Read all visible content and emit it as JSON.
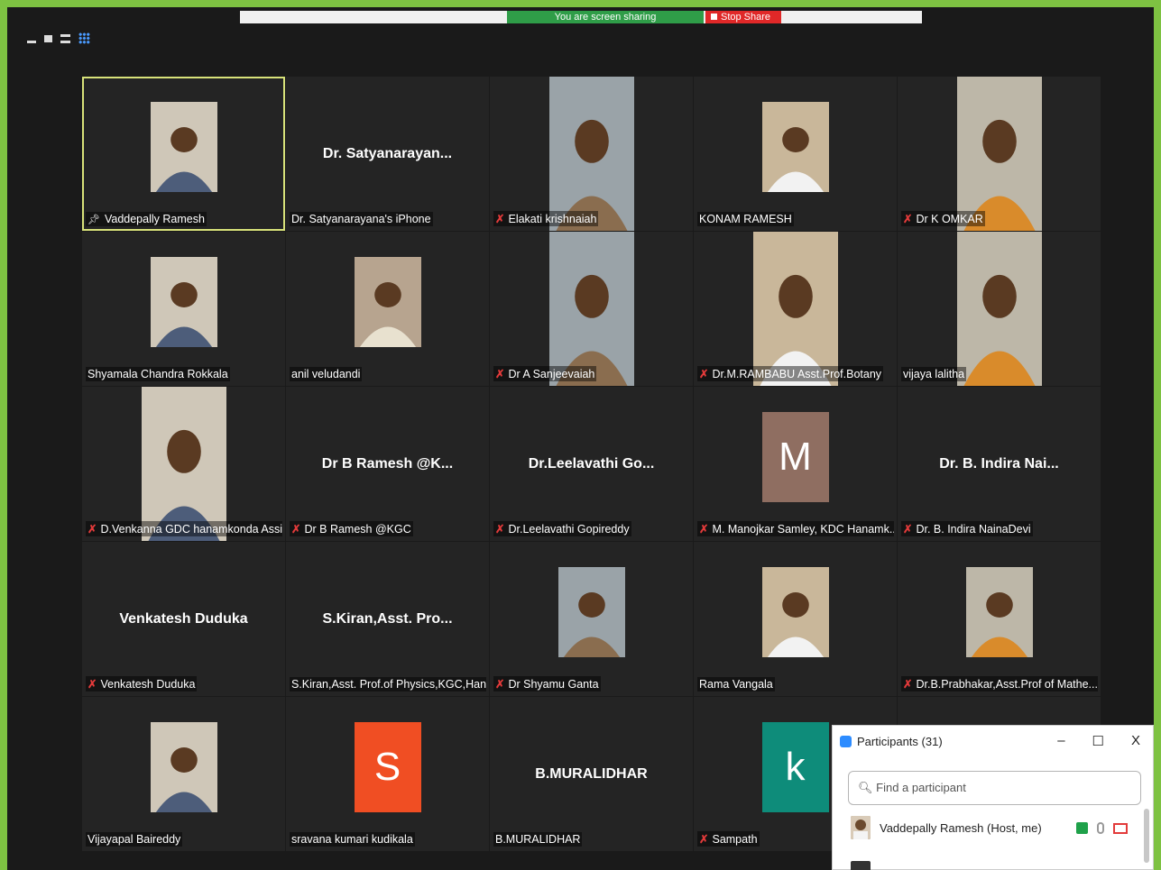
{
  "share_bar": {
    "status_text": "You are screen sharing",
    "stop_label": "Stop Share"
  },
  "tiles": [
    {
      "big": "",
      "caption": "Vaddepally Ramesh",
      "pin": true,
      "muted": false,
      "img": "photo-vaddepally",
      "active": true
    },
    {
      "big": "Dr. Satyanarayan...",
      "caption": "Dr. Satyanarayana's iPhone",
      "muted": false
    },
    {
      "big": "",
      "caption": "Elakati krishnaiah",
      "muted": true,
      "img": "video-elakati",
      "wide": true
    },
    {
      "big": "",
      "caption": "KONAM RAMESH",
      "muted": false,
      "img": "photo-konam"
    },
    {
      "big": "",
      "caption": "Dr K OMKAR",
      "muted": true,
      "img": "video-omkar",
      "wide": true
    },
    {
      "big": "",
      "caption": "Shyamala Chandra Rokkala",
      "muted": false,
      "img": "photo-shyamala"
    },
    {
      "big": "",
      "caption": "anil veludandi",
      "muted": false,
      "img": "photo-anil"
    },
    {
      "big": "",
      "caption": "Dr A Sanjeevaiah",
      "muted": true,
      "img": "video-sanjeevaiah",
      "wide": true
    },
    {
      "big": "",
      "caption": "Dr.M.RAMBABU Asst.Prof.Botany",
      "muted": true,
      "img": "video-rambabu",
      "wide": true
    },
    {
      "big": "",
      "caption": "vijaya lalitha",
      "muted": false,
      "img": "video-vijaya",
      "wide": true
    },
    {
      "big": "",
      "caption": "D.Venkanna GDC hanamkonda Assi...",
      "muted": true,
      "img": "video-venkanna",
      "wide": true
    },
    {
      "big": "Dr B Ramesh @K...",
      "caption": "Dr B Ramesh @KGC",
      "muted": true
    },
    {
      "big": "Dr.Leelavathi  Go...",
      "caption": "Dr.Leelavathi Gopireddy",
      "muted": true
    },
    {
      "big": "",
      "caption": "M. Manojkar Samley, KDC Hanamk...",
      "muted": true,
      "letter": "M",
      "letter_color": "#8f6e61"
    },
    {
      "big": "Dr. B. Indira Nai...",
      "caption": "Dr. B. Indira NainaDevi",
      "muted": true
    },
    {
      "big": "Venkatesh Duduka",
      "caption": "Venkatesh Duduka",
      "muted": true
    },
    {
      "big": "S.Kiran,Asst.  Pro...",
      "caption": "S.Kiran,Asst. Prof.of Physics,KGC,Hana...",
      "muted": false
    },
    {
      "big": "",
      "caption": "Dr Shyamu Ganta",
      "muted": true,
      "img": "photo-shyamu"
    },
    {
      "big": "",
      "caption": "Rama Vangala",
      "muted": false,
      "img": "photo-rama"
    },
    {
      "big": "",
      "caption": "Dr.B.Prabhakar,Asst.Prof of Mathe...",
      "muted": true,
      "img": "photo-prabhakar"
    },
    {
      "big": "",
      "caption": "Vijayapal Baireddy",
      "muted": false,
      "img": "photo-vijayapal"
    },
    {
      "big": "",
      "caption": "sravana kumari kudikala",
      "muted": false,
      "letter": "S",
      "letter_color": "#f04e23"
    },
    {
      "big": "B.MURALIDHAR",
      "caption": "B.MURALIDHAR",
      "muted": false
    },
    {
      "big": "",
      "caption": "Sampath",
      "muted": true,
      "letter": "k",
      "letter_color": "#0e8c7a"
    },
    {
      "big": "",
      "caption": "",
      "muted": false
    }
  ],
  "participants_panel": {
    "title": "Participants (31)",
    "search_placeholder": "Find a participant",
    "first_row_name": "Vaddepally Ramesh (Host, me)",
    "btn_min": "–",
    "btn_max": "☐",
    "btn_close": "X"
  },
  "colors": {
    "share_border": "#7ec242",
    "tile_bg": "#242424",
    "mute_red": "#e23a3a"
  }
}
